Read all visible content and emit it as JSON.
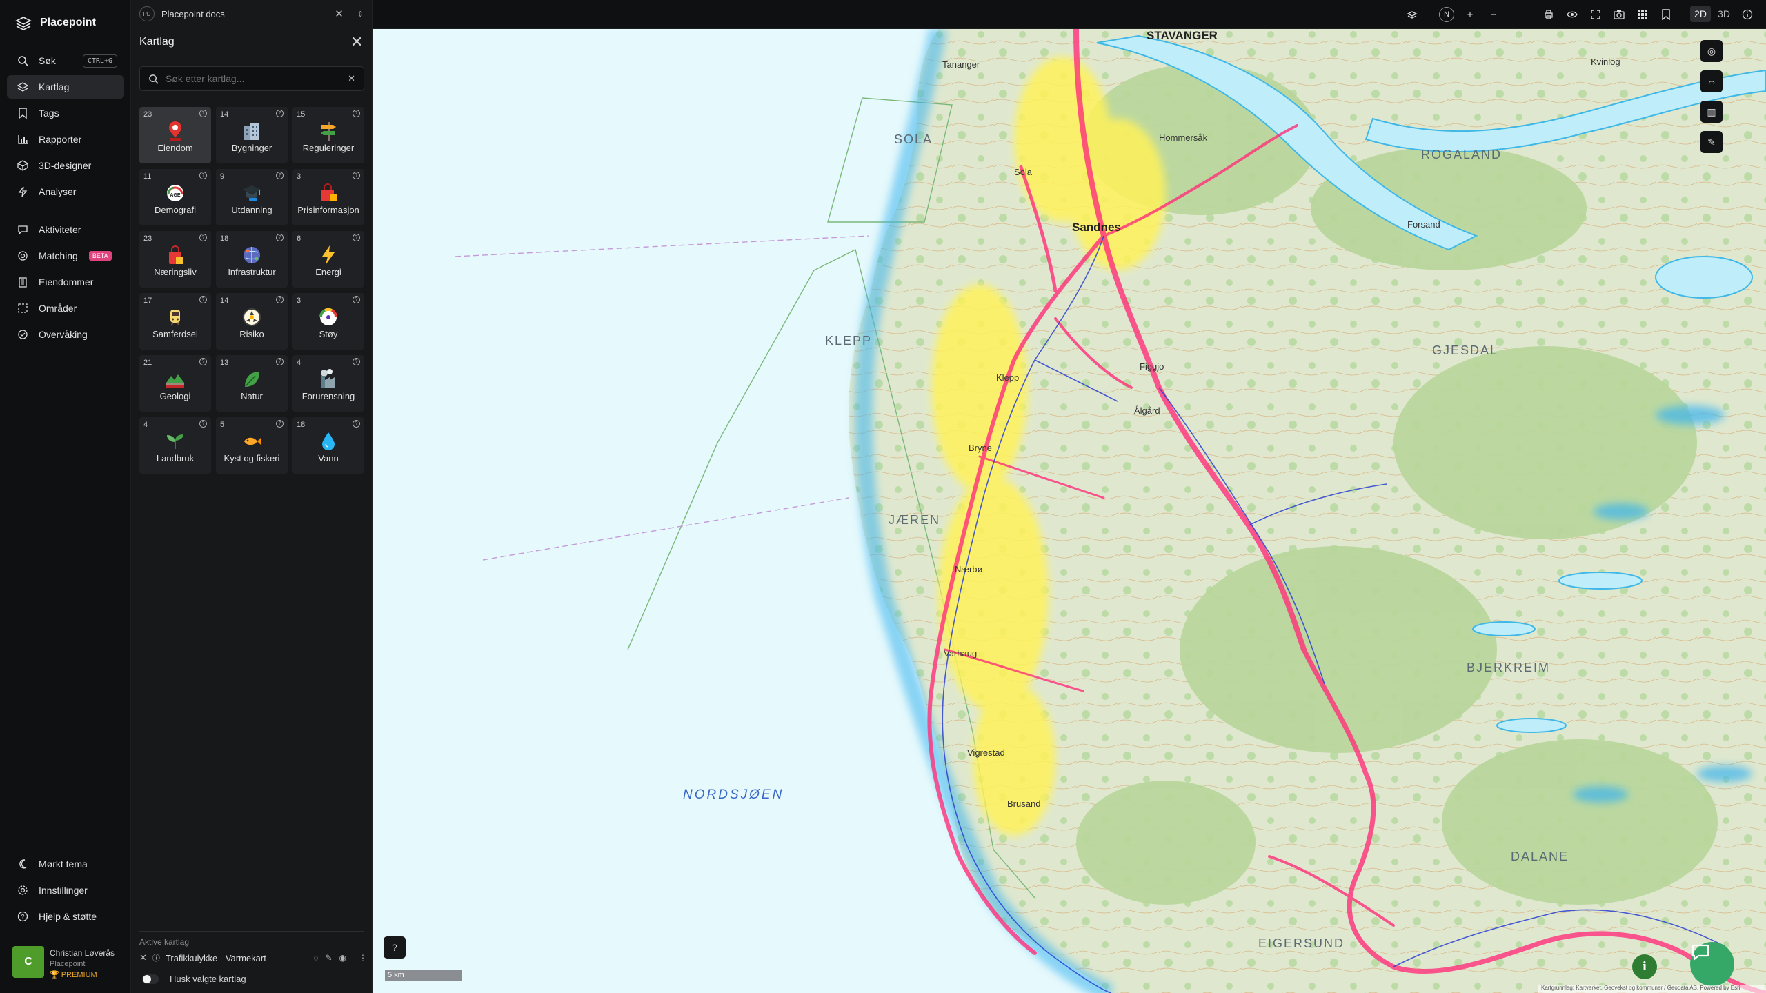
{
  "brand": {
    "name": "Placepoint"
  },
  "nav": {
    "items": [
      {
        "label": "Søk",
        "icon": "search-icon",
        "shortcut": "CTRL+G"
      },
      {
        "label": "Kartlag",
        "icon": "layers-icon",
        "active": true
      },
      {
        "label": "Tags",
        "icon": "bookmark-icon"
      },
      {
        "label": "Rapporter",
        "icon": "bar-chart-icon"
      },
      {
        "label": "3D-designer",
        "icon": "cube-icon"
      },
      {
        "label": "Analyser",
        "icon": "bolt-icon"
      },
      {
        "label": "Aktiviteter",
        "icon": "chat-icon"
      },
      {
        "label": "Matching",
        "icon": "target-icon",
        "badge": "BETA"
      },
      {
        "label": "Eiendommer",
        "icon": "building-icon"
      },
      {
        "label": "Områder",
        "icon": "area-icon"
      },
      {
        "label": "Overvåking",
        "icon": "monitor-icon"
      }
    ],
    "bottom": [
      {
        "label": "Mørkt tema",
        "icon": "moon-icon"
      },
      {
        "label": "Innstillinger",
        "icon": "gear-icon"
      },
      {
        "label": "Hjelp & støtte",
        "icon": "help-icon"
      }
    ]
  },
  "user": {
    "initial": "C",
    "name": "Christian Løverås",
    "org": "Placepoint",
    "plan": "PREMIUM"
  },
  "doc": {
    "badge": "PD",
    "title": "Placepoint docs"
  },
  "panel": {
    "title": "Kartlag",
    "search_placeholder": "Søk etter kartlag...",
    "categories": [
      {
        "count": "23",
        "label": "Eiendom",
        "icon": "property-pin-icon",
        "selected": true
      },
      {
        "count": "14",
        "label": "Bygninger",
        "icon": "buildings-icon"
      },
      {
        "count": "15",
        "label": "Reguleringer",
        "icon": "signpost-icon"
      },
      {
        "count": "11",
        "label": "Demografi",
        "icon": "age-gauge-icon"
      },
      {
        "count": "9",
        "label": "Utdanning",
        "icon": "graduation-cap-icon"
      },
      {
        "count": "3",
        "label": "Prisinformasjon",
        "icon": "price-bag-icon"
      },
      {
        "count": "23",
        "label": "Næringsliv",
        "icon": "shopping-bag-icon"
      },
      {
        "count": "18",
        "label": "Infrastruktur",
        "icon": "network-globe-icon"
      },
      {
        "count": "6",
        "label": "Energi",
        "icon": "lightning-icon"
      },
      {
        "count": "17",
        "label": "Samferdsel",
        "icon": "train-icon"
      },
      {
        "count": "14",
        "label": "Risiko",
        "icon": "hazard-icon"
      },
      {
        "count": "3",
        "label": "Støy",
        "icon": "noise-gauge-icon"
      },
      {
        "count": "21",
        "label": "Geologi",
        "icon": "terrain-icon"
      },
      {
        "count": "13",
        "label": "Natur",
        "icon": "leaf-icon"
      },
      {
        "count": "4",
        "label": "Forurensning",
        "icon": "factory-icon"
      },
      {
        "count": "4",
        "label": "Landbruk",
        "icon": "sprout-icon"
      },
      {
        "count": "5",
        "label": "Kyst og fiskeri",
        "icon": "fish-icon"
      },
      {
        "count": "18",
        "label": "Vann",
        "icon": "water-drop-icon"
      }
    ],
    "active_header": "Aktive kartlag",
    "active_layer": "Trafikkulykke - Varmekart",
    "remember_label": "Husk valgte kartlag"
  },
  "topbar": {
    "compass": "N",
    "mode_2d": "2D",
    "mode_3d": "3D",
    "active_mode": "2D"
  },
  "map": {
    "places": [
      {
        "name": "STAVANGER",
        "kind": "big"
      },
      {
        "name": "Sandnes",
        "kind": "big"
      },
      {
        "name": "Sola",
        "kind": "town"
      },
      {
        "name": "SOLA",
        "kind": "region"
      },
      {
        "name": "KLEPP",
        "kind": "region"
      },
      {
        "name": "Klepp",
        "kind": "town"
      },
      {
        "name": "Bryne",
        "kind": "town"
      },
      {
        "name": "JÆREN",
        "kind": "region"
      },
      {
        "name": "Nærbø",
        "kind": "town"
      },
      {
        "name": "Varhaug",
        "kind": "town"
      },
      {
        "name": "Vigrestad",
        "kind": "town"
      },
      {
        "name": "Brusand",
        "kind": "town"
      },
      {
        "name": "Ålgård",
        "kind": "town"
      },
      {
        "name": "Figgjo",
        "kind": "town"
      },
      {
        "name": "ROGALAND",
        "kind": "region"
      },
      {
        "name": "GJESDAL",
        "kind": "region"
      },
      {
        "name": "BJERKREIM",
        "kind": "region"
      },
      {
        "name": "EIGERSUND",
        "kind": "region"
      },
      {
        "name": "DALANE",
        "kind": "region"
      },
      {
        "name": "NORDSJØEN",
        "kind": "sea"
      },
      {
        "name": "Hommersåk",
        "kind": "town"
      },
      {
        "name": "Tananger",
        "kind": "town"
      },
      {
        "name": "Forsand",
        "kind": "town"
      },
      {
        "name": "Kvinlog",
        "kind": "town"
      }
    ],
    "scale_label": "5 km",
    "attribution": "Kartgrunnlag: Kartverket, Geovekst og kommuner / Geodata AS, Powered by Esri"
  }
}
